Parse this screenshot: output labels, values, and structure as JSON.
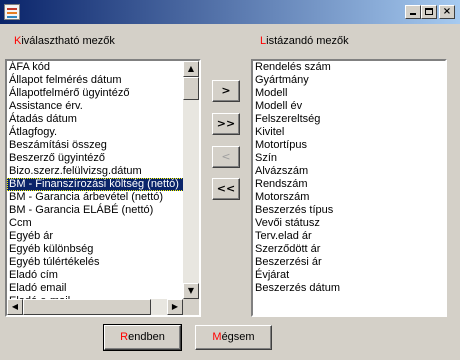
{
  "window": {
    "icon": "app-icon",
    "controls": {
      "minimize": "minimize-icon",
      "maximize": "maximize-icon",
      "close": "×"
    }
  },
  "left_label": {
    "hot": "K",
    "rest": "iválasztható mezők"
  },
  "right_label": {
    "hot": "L",
    "rest": "istázandó mezők"
  },
  "left_list": {
    "selected_index": 9,
    "items": [
      "ÁFA kód",
      "Állapot felmérés dátum",
      "Állapotfelmérő ügyintéző",
      "Assistance érv.",
      "Átadás dátum",
      "Átlagfogy.",
      "Beszámítási összeg",
      "Beszerző ügyintéző",
      "Bizo.szerz.felülvizsg.dátum",
      "BM - Finanszírozási költség (nettó)",
      "BM - Garancia árbevétel (nettó)",
      "BM - Garancia ELÁBÉ (nettó)",
      "Ccm",
      "Egyéb ár",
      "Egyéb különbség",
      "Egyéb túlértékelés",
      "Eladó cím",
      "Eladó email",
      "Eladó e-mail"
    ]
  },
  "right_list": {
    "items": [
      "Rendelés szám",
      "Gyártmány",
      "Modell",
      "Modell év",
      "Felszereltség",
      "Kivitel",
      "Motortípus",
      "Szín",
      "Alvázszám",
      "Rendszám",
      "Motorszám",
      "Beszerzés típus",
      "Vevői státusz",
      "Terv.elad ár",
      "Szerződött ár",
      "Beszerzési ár",
      "Évjárat",
      "Beszerzés dátum"
    ]
  },
  "move_buttons": {
    "add_one": ">",
    "add_all": ">>",
    "remove_one": "<",
    "remove_all": "<<"
  },
  "buttons": {
    "ok": {
      "hot": "R",
      "rest": "endben"
    },
    "cancel": {
      "hot": "M",
      "rest": "égsem"
    }
  },
  "colors": {
    "title_start": "#0a246a",
    "title_end": "#a6caf0",
    "accent_letter": "#ff0000",
    "selection": "#0a246a"
  }
}
